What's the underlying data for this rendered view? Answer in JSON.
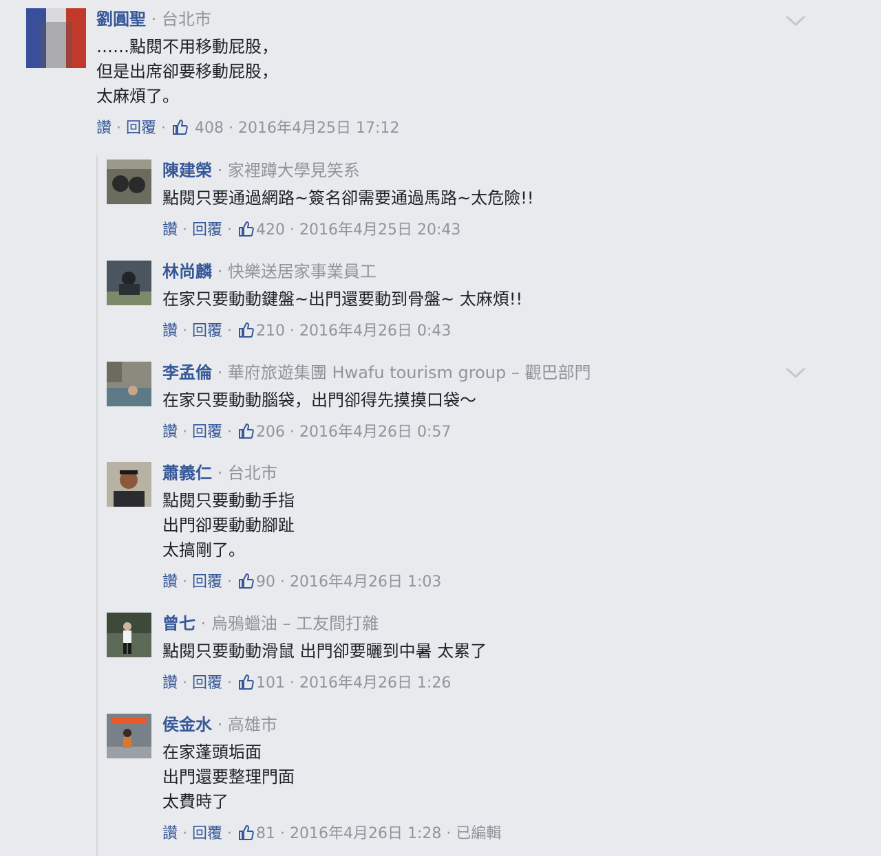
{
  "top_comment": {
    "author": "劉圓聖",
    "meta": "台北市",
    "lines": [
      "……點閱不用移動屁股，",
      "但是出席卻要移動屁股，",
      "太麻煩了。"
    ],
    "like_label": "讚",
    "reply_label": "回覆",
    "likes": "408",
    "timestamp": "2016年4月25日 17:12",
    "avatar_icon": "french-flag-avatar"
  },
  "replies": [
    {
      "author": "陳建榮",
      "meta": "家裡蹲大學見笑系",
      "lines": [
        "點閱只要通過網路~簽名卻需要通過馬路~太危險!!"
      ],
      "like_label": "讚",
      "reply_label": "回覆",
      "likes": "420",
      "timestamp": "2016年4月25日 20:43"
    },
    {
      "author": "林尚麟",
      "meta": "快樂送居家事業員工",
      "lines": [
        "在家只要動動鍵盤~出門還要動到骨盤~ 太麻煩!!"
      ],
      "like_label": "讚",
      "reply_label": "回覆",
      "likes": "210",
      "timestamp": "2016年4月26日 0:43"
    },
    {
      "author": "李孟倫",
      "meta": "華府旅遊集團 Hwafu tourism group – 觀巴部門",
      "lines": [
        "在家只要動動腦袋，出門卻得先摸摸口袋～"
      ],
      "like_label": "讚",
      "reply_label": "回覆",
      "likes": "206",
      "timestamp": "2016年4月26日 0:57"
    },
    {
      "author": "蕭義仁",
      "meta": "台北市",
      "lines": [
        "點閱只要動動手指",
        "出門卻要動動腳趾",
        "太搞剛了。"
      ],
      "like_label": "讚",
      "reply_label": "回覆",
      "likes": "90",
      "timestamp": "2016年4月26日 1:03"
    },
    {
      "author": "曾七",
      "meta": "烏鴉蠟油 – 工友間打雜",
      "lines": [
        "點閱只要動動滑鼠 出門卻要曬到中暑 太累了"
      ],
      "like_label": "讚",
      "reply_label": "回覆",
      "likes": "101",
      "timestamp": "2016年4月26日 1:26"
    },
    {
      "author": "侯金水",
      "meta": "高雄市",
      "lines": [
        "在家蓬頭垢面",
        "出門還要整理門面",
        "太費時了"
      ],
      "like_label": "讚",
      "reply_label": "回覆",
      "likes": "81",
      "timestamp": "2016年4月26日 1:28",
      "edited": "已編輯"
    }
  ],
  "colors": {
    "background": "#e9eaed",
    "link": "#365899",
    "meta": "#90949c"
  }
}
